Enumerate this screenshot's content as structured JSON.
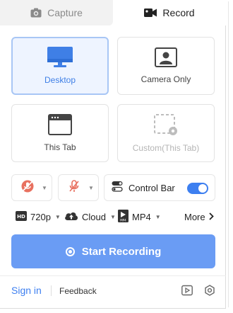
{
  "tabs": {
    "capture_label": "Capture",
    "capture_icon": "camera-icon",
    "record_label": "Record",
    "record_icon": "video-camera-icon",
    "active": "Record"
  },
  "modes": [
    {
      "label": "Desktop",
      "icon": "monitor-icon",
      "selected": true
    },
    {
      "label": "Camera Only",
      "icon": "camera-portrait-icon",
      "selected": false
    },
    {
      "label": "This Tab",
      "icon": "browser-tab-icon",
      "selected": false
    },
    {
      "label": "Custom(This Tab)",
      "icon": "region-select-icon",
      "selected": false
    }
  ],
  "controls": {
    "microphone": {
      "icon": "microphone-off-icon",
      "state": "off"
    },
    "audio": {
      "icon": "speaker-off-icon",
      "state": "off"
    },
    "control_bar": {
      "label": "Control Bar",
      "icon": "toggle-settings-icon",
      "enabled": true
    }
  },
  "options": {
    "resolution": {
      "label": "720p",
      "icon": "hd-icon"
    },
    "storage": {
      "label": "Cloud",
      "icon": "cloud-upload-icon"
    },
    "format": {
      "label": "MP4",
      "icon": "mp4-file-icon"
    },
    "more_label": "More"
  },
  "start_button": {
    "label": "Start Recording",
    "icon": "record-icon"
  },
  "footer": {
    "sign_in": "Sign in",
    "feedback": "Feedback",
    "icons": [
      "play-library-icon",
      "settings-hex-icon"
    ]
  },
  "colors": {
    "accent": "#3d7ff0",
    "start_button": "#6a9cf4",
    "selected_bg": "#eef4ff",
    "selected_border": "#a8c6f5",
    "muted_red": "#e8705f"
  }
}
